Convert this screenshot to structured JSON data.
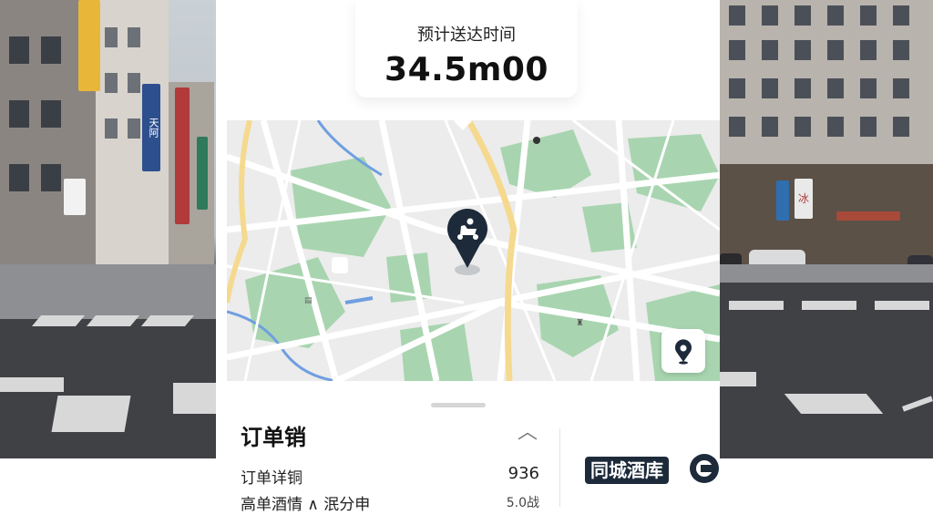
{
  "eta": {
    "label": "预计送达时间",
    "value": "34.5m00"
  },
  "order": {
    "title": "订单销",
    "rows": [
      {
        "label": "订单详铜",
        "value": "936"
      },
      {
        "label": "高单酒情 ∧ 泯分申",
        "value": "5.0战"
      }
    ]
  },
  "brand": {
    "name": "同城酒库"
  },
  "map": {
    "rider_icon": "scooter-rider-icon",
    "locate_icon": "locate-pin-icon"
  },
  "street_signs": [
    "天阿",
    "冰"
  ],
  "colors": {
    "dark_navy": "#1d2a3a",
    "map_green": "#a8d5b0",
    "map_road_yellow": "#f5d98e",
    "map_water": "#6f9fe0"
  }
}
